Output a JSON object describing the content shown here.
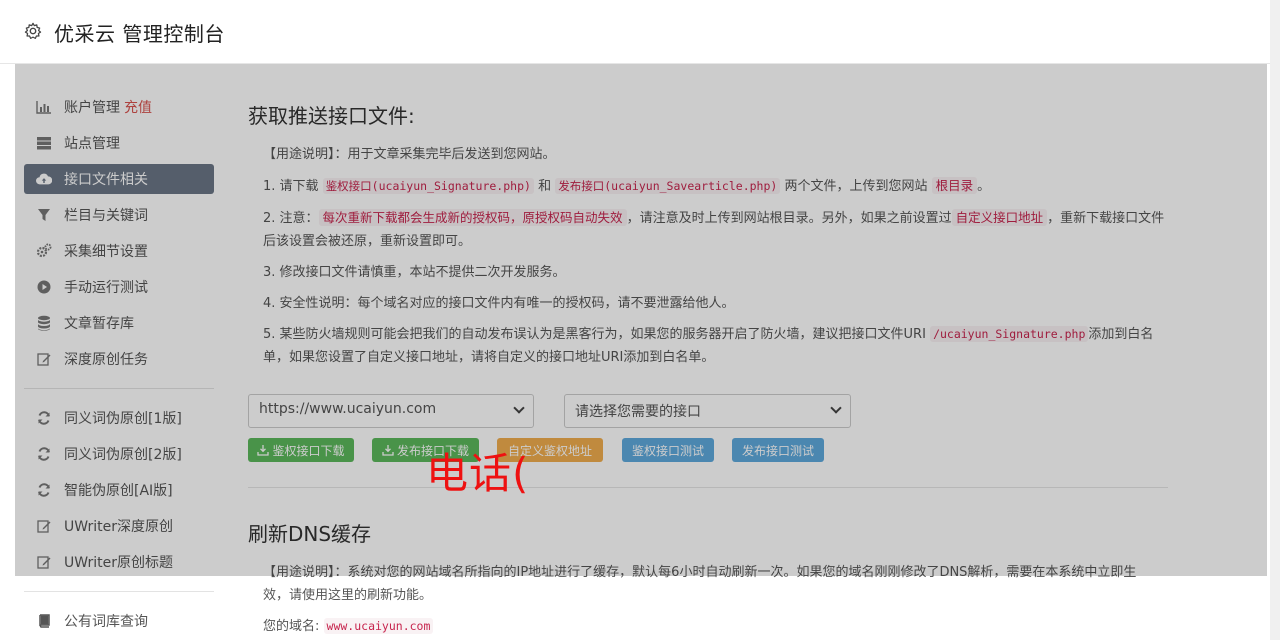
{
  "header": {
    "title": "优采云 管理控制台",
    "icon": "gear-icon"
  },
  "sidebar": {
    "items": [
      {
        "label": "账户管理",
        "badge": "充值",
        "icon": "bar-chart-icon"
      },
      {
        "label": "站点管理",
        "icon": "server-icon"
      },
      {
        "label": "接口文件相关",
        "icon": "cloud-upload-icon",
        "active": true
      },
      {
        "label": "栏目与关键词",
        "icon": "filter-icon"
      },
      {
        "label": "采集细节设置",
        "icon": "cogs-icon"
      },
      {
        "label": "手动运行测试",
        "icon": "play-circle-icon"
      },
      {
        "label": "文章暂存库",
        "icon": "database-icon"
      },
      {
        "label": "深度原创任务",
        "icon": "edit-icon"
      }
    ],
    "group2": [
      {
        "label": "同义词伪原创[1版]",
        "icon": "refresh-icon"
      },
      {
        "label": "同义词伪原创[2版]",
        "icon": "refresh-icon"
      },
      {
        "label": "智能伪原创[AI版]",
        "icon": "refresh-icon"
      },
      {
        "label": "UWriter深度原创",
        "icon": "edit-icon"
      },
      {
        "label": "UWriter原创标题",
        "icon": "edit-icon"
      }
    ],
    "group3": [
      {
        "label": "公有词库查询",
        "icon": "book-icon"
      }
    ]
  },
  "push": {
    "title": "获取推送接口文件:",
    "usage": "【用途说明】：用于文章采集完毕后发送到您网站。",
    "p1_a": "1. 请下载",
    "p1_code1": "鉴权接口(ucaiyun_Signature.php)",
    "p1_b": "和",
    "p1_code2": "发布接口(ucaiyun_Savearticle.php)",
    "p1_c": "两个文件，上传到您网站",
    "p1_code3": "根目录",
    "p1_d": "。",
    "p2_a": "2. 注意：",
    "p2_code1": "每次重新下载都会生成新的授权码，原授权码自动失效",
    "p2_b": "，请注意及时上传到网站根目录。另外，如果之前设置过",
    "p2_code2": "自定义接口地址",
    "p2_c": "，重新下载接口文件后该设置会被还原，重新设置即可。",
    "p3": "3. 修改接口文件请慎重，本站不提供二次开发服务。",
    "p4": "4. 安全性说明：每个域名对应的接口文件内有唯一的授权码，请不要泄露给他人。",
    "p5_a": "5. 某些防火墙规则可能会把我们的自动发布误认为是黑客行为，如果您的服务器开启了防火墙，建议把接口文件URI",
    "p5_code": "/ucaiyun_Signature.php",
    "p5_b": "添加到白名单，如果您设置了自定义接口地址，请将自定义的接口地址URI添加到白名单。",
    "site_select": "https://www.ucaiyun.com",
    "api_select": "请选择您需要的接口",
    "btn_sig": "鉴权接口下载",
    "btn_pub": "发布接口下载",
    "btn_custom": "自定义鉴权地址",
    "btn_sig_test": "鉴权接口测试",
    "btn_pub_test": "发布接口测试"
  },
  "dns": {
    "title": "刷新DNS缓存",
    "usage": "【用途说明】：系统对您的网站域名所指向的IP地址进行了缓存，默认每6小时自动刷新一次。如果您的域名刚刚修改了DNS解析，需要在本系统中立即生效，请使用这里的刷新功能。",
    "domain_label": "您的域名:",
    "domain_value": "www.ucaiyun.com"
  },
  "overlay_text": "电话("
}
